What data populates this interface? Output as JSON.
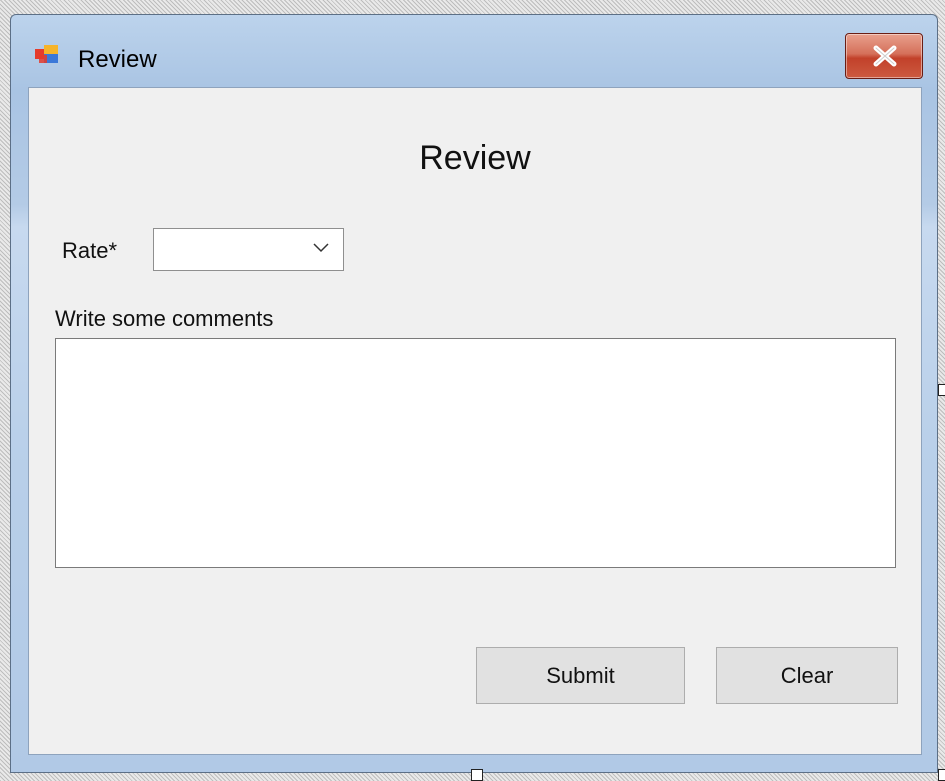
{
  "window": {
    "title": "Review",
    "app_icon": "windows-form-icon",
    "close_icon": "close-icon"
  },
  "form": {
    "heading": "Review",
    "rate_label": "Rate*",
    "rate_value": "",
    "rate_dropdown_icon": "chevron-down-icon",
    "comments_label": "Write some comments",
    "comments_value": "",
    "submit_label": "Submit",
    "clear_label": "Clear"
  },
  "colors": {
    "close_button": "#c7452c",
    "client_background": "#f0f0f0",
    "titlebar": "#b4cbe6"
  }
}
